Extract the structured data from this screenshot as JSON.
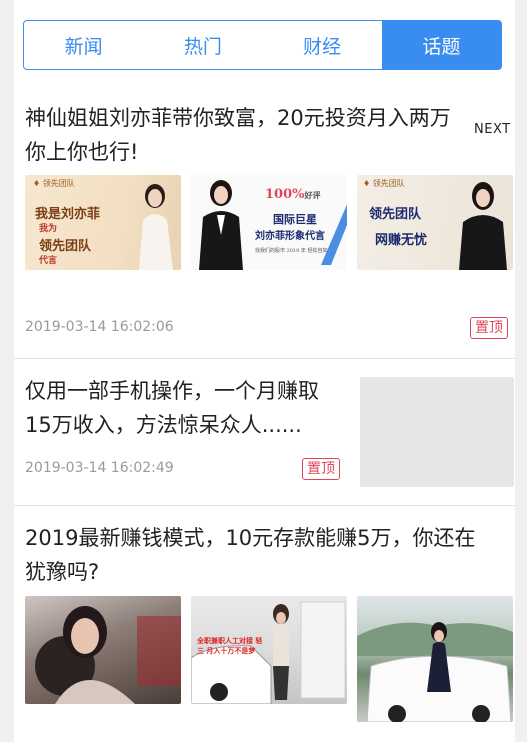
{
  "tabs": [
    {
      "label": "新闻",
      "active": false
    },
    {
      "label": "热门",
      "active": false
    },
    {
      "label": "财经",
      "active": false
    },
    {
      "label": "话题",
      "active": true
    }
  ],
  "next_label": "NEXT",
  "articles": [
    {
      "title_line1": "神仙姐姐刘亦菲带你致富，20元投资月入两万",
      "title_line2": "你上你也行!",
      "date": "2019-03-14 16:02:06",
      "badge": "置顶",
      "thumbs": [
        {
          "logo": "领先团队",
          "line1": "我是刘亦菲",
          "line2": "我为",
          "line3": "领先团队",
          "line4": "代言"
        },
        {
          "line1": "100%",
          "line1b": "好评",
          "line2": "国际巨星",
          "line3": "刘亦菲形象代言",
          "line4": "找我们的股市 2019 年 轻松自如"
        },
        {
          "logo": "领先团队",
          "line1": "领先团队",
          "line2": "网赚无忧"
        }
      ]
    },
    {
      "title_line1": "仅用一部手机操作，一个月赚取",
      "title_line2": "15万收入，方法惊呆众人......",
      "date": "2019-03-14 16:02:49",
      "badge": "置顶"
    },
    {
      "title_line1": "2019最新赚钱模式，10元存款能赚5万，你还在",
      "title_line2": "犹豫吗?",
      "thumbs": [
        {
          "caption": ""
        },
        {
          "caption": "全职兼职人工对接 轻三 月入十万不是梦"
        },
        {
          "caption": ""
        }
      ]
    }
  ],
  "colors": {
    "accent": "#3a8df0",
    "badge": "#e0465a",
    "date": "#9a9a9a"
  }
}
